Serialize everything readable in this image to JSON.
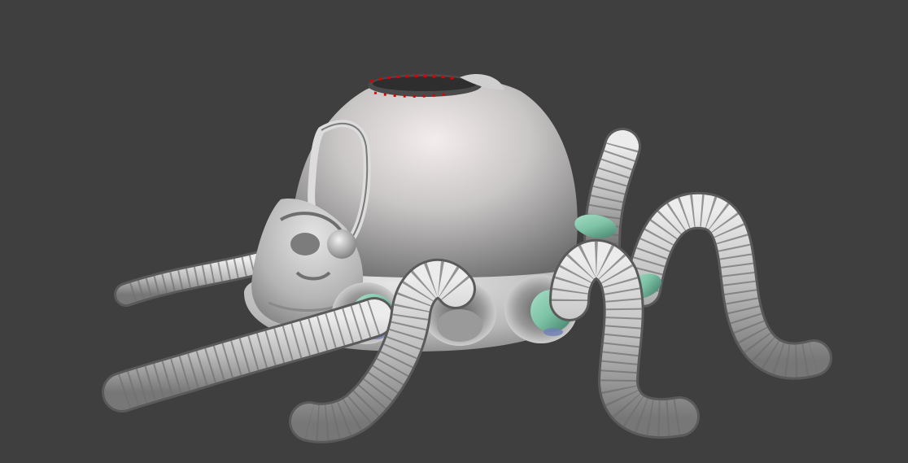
{
  "viewport": {
    "background": "#3f3f3f"
  },
  "model": {
    "shell_color": "#c4c4c4",
    "collar_color": "#7dc2a6",
    "accent_color": "#6f7fb8",
    "highlight_color": "#e10000",
    "icon": "octopus-sculpt-model"
  }
}
